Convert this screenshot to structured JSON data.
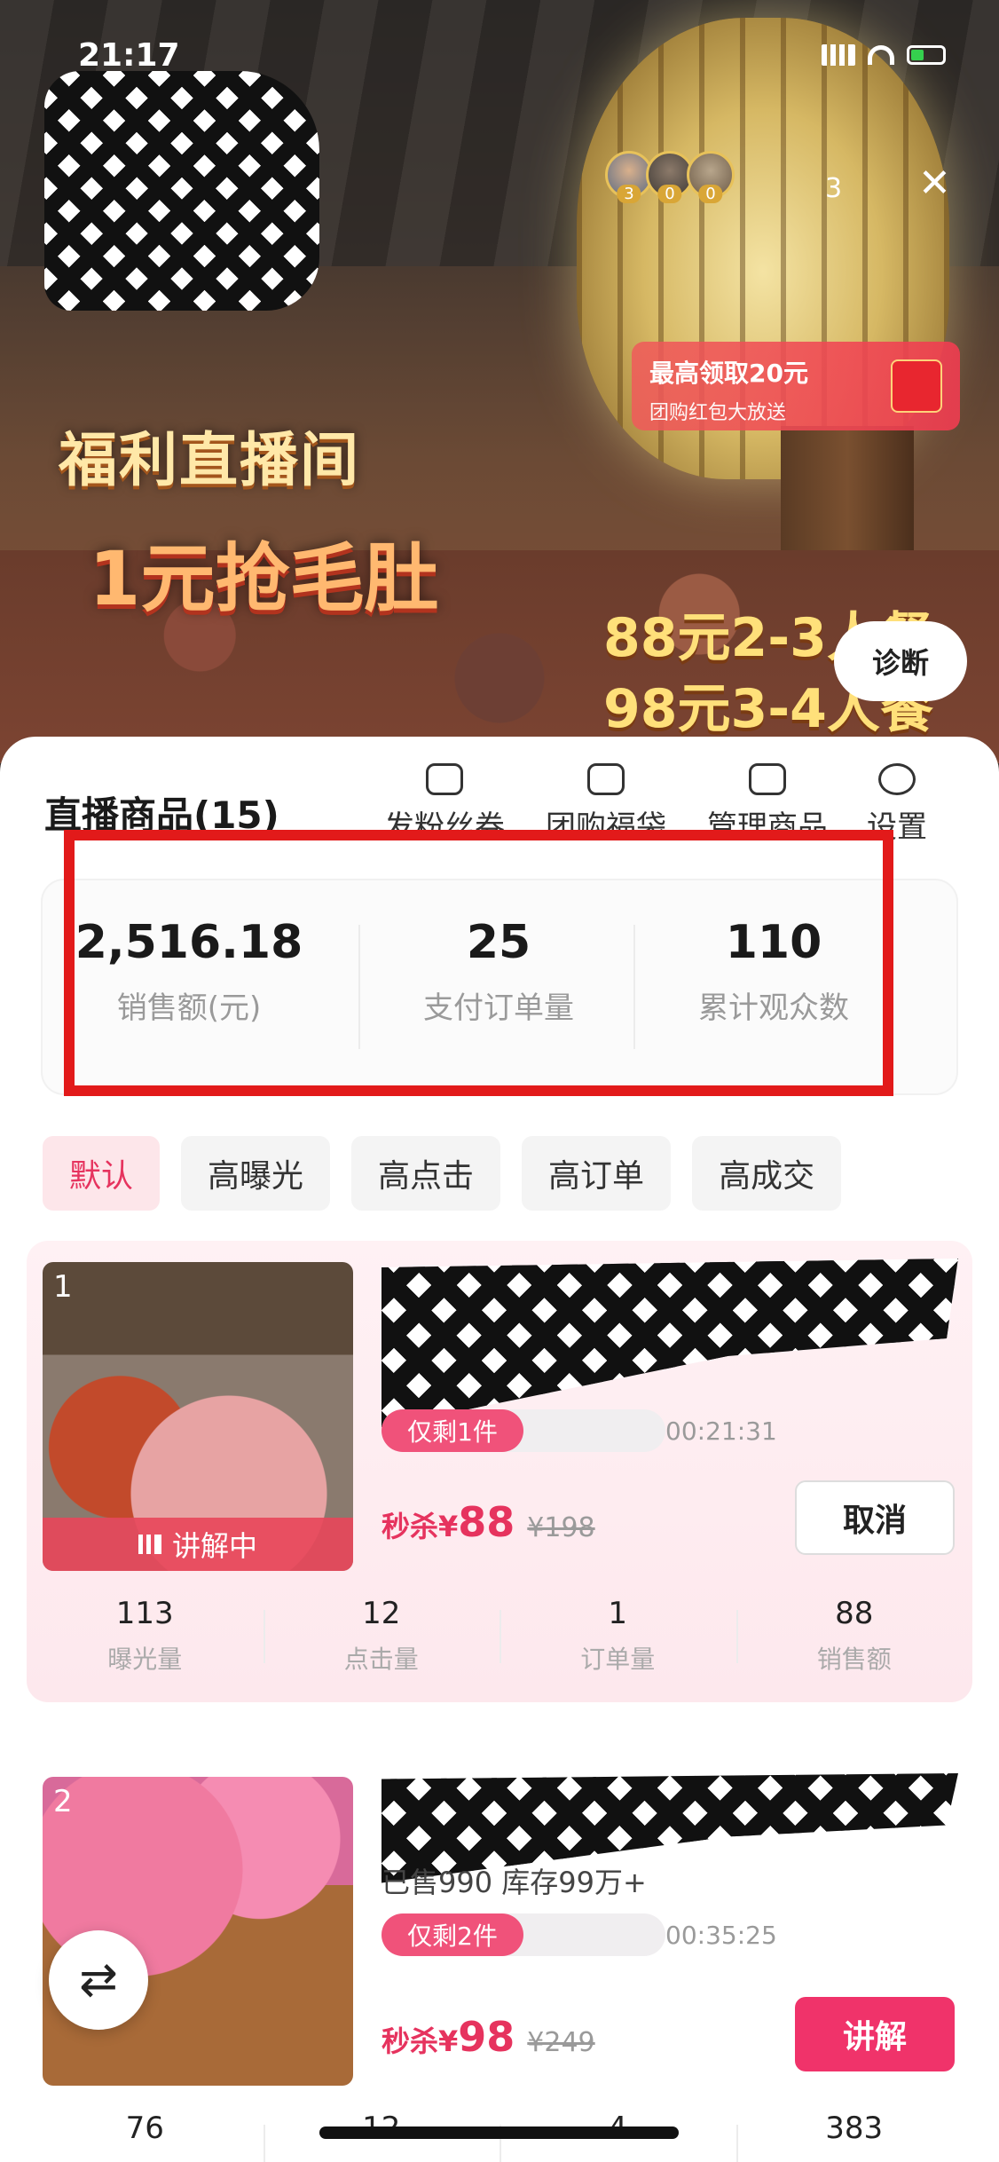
{
  "status_bar": {
    "time": "21:17"
  },
  "live": {
    "avatar_badges": [
      "3",
      "0",
      "0"
    ],
    "viewer_count": "3",
    "close_icon": "close-icon",
    "promo_banner": {
      "title": "最高领取20元",
      "subtitle": "团购红包大放送"
    },
    "headline": "福利直播间",
    "deal_main": "1元抢毛肚",
    "deal_lines": [
      "88元2-3人餐",
      "98元3-4人餐"
    ],
    "diagnose_button": "诊断"
  },
  "panel": {
    "title": "直播商品(15)",
    "tools": [
      {
        "label": "发粉丝券",
        "icon": "ticket-icon"
      },
      {
        "label": "团购福袋",
        "icon": "bag-icon"
      },
      {
        "label": "管理商品",
        "icon": "shop-icon"
      },
      {
        "label": "设置",
        "icon": "gear-icon"
      }
    ],
    "stats": [
      {
        "value": "2,516.18",
        "label": "销售额(元)"
      },
      {
        "value": "25",
        "label": "支付订单量"
      },
      {
        "value": "110",
        "label": "累计观众数"
      }
    ],
    "filters": [
      "默认",
      "高曝光",
      "高点击",
      "高订单",
      "高成交"
    ],
    "active_filter": "默认"
  },
  "products": [
    {
      "rank": "1",
      "status_label": "讲解中",
      "stock_label": "仅剩1件",
      "timer": "00:21:31",
      "price_prefix": "秒杀¥",
      "price": "88",
      "original_price": "¥198",
      "action": "取消",
      "metrics": [
        {
          "value": "113",
          "label": "曝光量"
        },
        {
          "value": "12",
          "label": "点击量"
        },
        {
          "value": "1",
          "label": "订单量"
        },
        {
          "value": "88",
          "label": "销售额"
        }
      ]
    },
    {
      "rank": "2",
      "sold_stock": "已售990  库存99万+",
      "stock_label": "仅剩2件",
      "timer": "00:35:25",
      "price_prefix": "秒杀¥",
      "price": "98",
      "original_price": "¥249",
      "action": "讲解",
      "metrics": [
        {
          "value": "76"
        },
        {
          "value": "12"
        },
        {
          "value": "4"
        },
        {
          "value": "383"
        }
      ]
    }
  ],
  "swap_icon": "swap-icon"
}
